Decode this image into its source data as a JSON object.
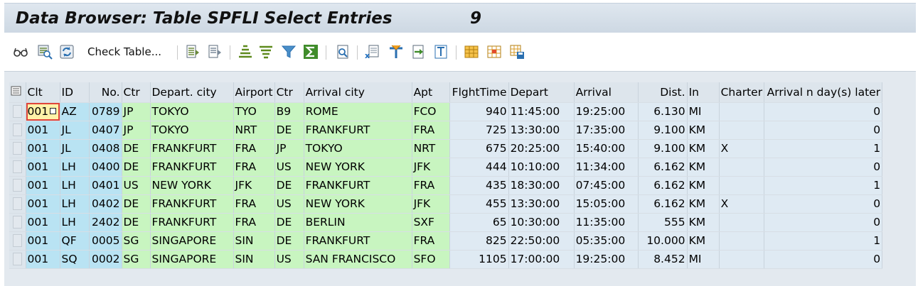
{
  "window": {
    "title": "Data Browser: Table SPFLI Select Entries",
    "count": "9"
  },
  "toolbar": {
    "check_table_label": "Check Table...",
    "icons": [
      "glasses-icon",
      "select-view-icon",
      "refresh-icon",
      "detail-icon",
      "detail2-icon",
      "sort-asc-icon",
      "sort-desc-icon",
      "filter-icon",
      "sum-icon",
      "print-preview-icon",
      "export-excel-icon",
      "abc-analysis-icon",
      "export-icon",
      "word-processing-icon",
      "layout-select-icon",
      "layout-change-icon",
      "layout-save-icon"
    ]
  },
  "colors": {
    "key_column": "#b9e3f3",
    "text_column": "#c8f5c0",
    "data_column": "#dfeaf3",
    "title_bar": "#d6dfe8"
  },
  "table": {
    "columns": [
      "Clt",
      "ID",
      "No.",
      "Ctr",
      "Depart. city",
      "Airport",
      "Ctr",
      "Arrival city",
      "Apt",
      "FlghtTime",
      "Depart",
      "Arrival",
      "Dist.",
      "In",
      "Charter",
      "Arrival n day(s) later"
    ],
    "rows": [
      [
        "001",
        "AZ",
        "0789",
        "JP",
        "TOKYO",
        "TYO",
        "B9",
        "ROME",
        "FCO",
        "940",
        "11:45:00",
        "19:25:00",
        "6.130",
        "MI",
        "",
        "0"
      ],
      [
        "001",
        "JL",
        "0407",
        "JP",
        "TOKYO",
        "NRT",
        "DE",
        "FRANKFURT",
        "FRA",
        "725",
        "13:30:00",
        "17:35:00",
        "9.100",
        "KM",
        "",
        "0"
      ],
      [
        "001",
        "JL",
        "0408",
        "DE",
        "FRANKFURT",
        "FRA",
        "JP",
        "TOKYO",
        "NRT",
        "675",
        "20:25:00",
        "15:40:00",
        "9.100",
        "KM",
        "X",
        "1"
      ],
      [
        "001",
        "LH",
        "0400",
        "DE",
        "FRANKFURT",
        "FRA",
        "US",
        "NEW YORK",
        "JFK",
        "444",
        "10:10:00",
        "11:34:00",
        "6.162",
        "KM",
        "",
        "0"
      ],
      [
        "001",
        "LH",
        "0401",
        "US",
        "NEW YORK",
        "JFK",
        "DE",
        "FRANKFURT",
        "FRA",
        "435",
        "18:30:00",
        "07:45:00",
        "6.162",
        "KM",
        "",
        "1"
      ],
      [
        "001",
        "LH",
        "0402",
        "DE",
        "FRANKFURT",
        "FRA",
        "US",
        "NEW YORK",
        "JFK",
        "455",
        "13:30:00",
        "15:05:00",
        "6.162",
        "KM",
        "X",
        "0"
      ],
      [
        "001",
        "LH",
        "2402",
        "DE",
        "FRANKFURT",
        "FRA",
        "DE",
        "BERLIN",
        "SXF",
        "65",
        "10:30:00",
        "11:35:00",
        "555",
        "KM",
        "",
        "0"
      ],
      [
        "001",
        "QF",
        "0005",
        "SG",
        "SINGAPORE",
        "SIN",
        "DE",
        "FRANKFURT",
        "FRA",
        "825",
        "22:50:00",
        "05:35:00",
        "10.000",
        "KM",
        "",
        "1"
      ],
      [
        "001",
        "SQ",
        "0002",
        "SG",
        "SINGAPORE",
        "SIN",
        "US",
        "SAN FRANCISCO",
        "SFO",
        "1105",
        "17:00:00",
        "19:25:00",
        "8.452",
        "MI",
        "",
        "0"
      ]
    ]
  }
}
